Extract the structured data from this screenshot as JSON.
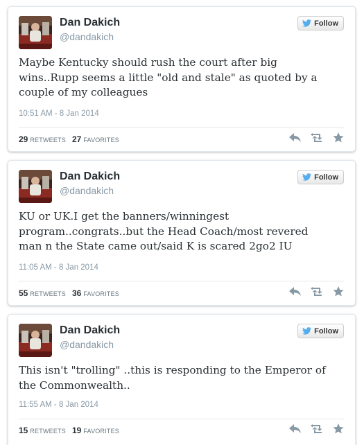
{
  "tweets": [
    {
      "name": "Dan Dakich",
      "handle": "@dandakich",
      "follow_label": "Follow",
      "text": "Maybe Kentucky should rush the court after big\nwins..Rupp seems a little \"old and stale\" as quoted by a\ncouple of my colleagues",
      "timestamp": "10:51 AM - 8 Jan 2014",
      "retweets_count": "29",
      "retweets_label": "RETWEETS",
      "favorites_count": "27",
      "favorites_label": "FAVORITES"
    },
    {
      "name": "Dan Dakich",
      "handle": "@dandakich",
      "follow_label": "Follow",
      "text": "KU or UK.I get the banners/winningest\nprogram..congrats..but the Head Coach/most revered\nman n the State came out/said K is scared 2go2 IU",
      "timestamp": "11:05 AM - 8 Jan 2014",
      "retweets_count": "55",
      "retweets_label": "RETWEETS",
      "favorites_count": "36",
      "favorites_label": "FAVORITES"
    },
    {
      "name": "Dan Dakich",
      "handle": "@dandakich",
      "follow_label": "Follow",
      "text": "This isn't \"trolling\" ..this is responding to the Emperor of\nthe Commonwealth..",
      "timestamp": "11:55 AM - 8 Jan 2014",
      "retweets_count": "15",
      "retweets_label": "RETWEETS",
      "favorites_count": "19",
      "favorites_label": "FAVORITES"
    }
  ],
  "icons": {
    "bird": "twitter-bird-icon",
    "reply": "reply-icon",
    "retweet": "retweet-icon",
    "favorite": "star-icon"
  },
  "colors": {
    "bird_blue": "#55acee",
    "name": "#292f33",
    "meta_gray": "#8899a6",
    "action_gray": "#8899a6"
  }
}
